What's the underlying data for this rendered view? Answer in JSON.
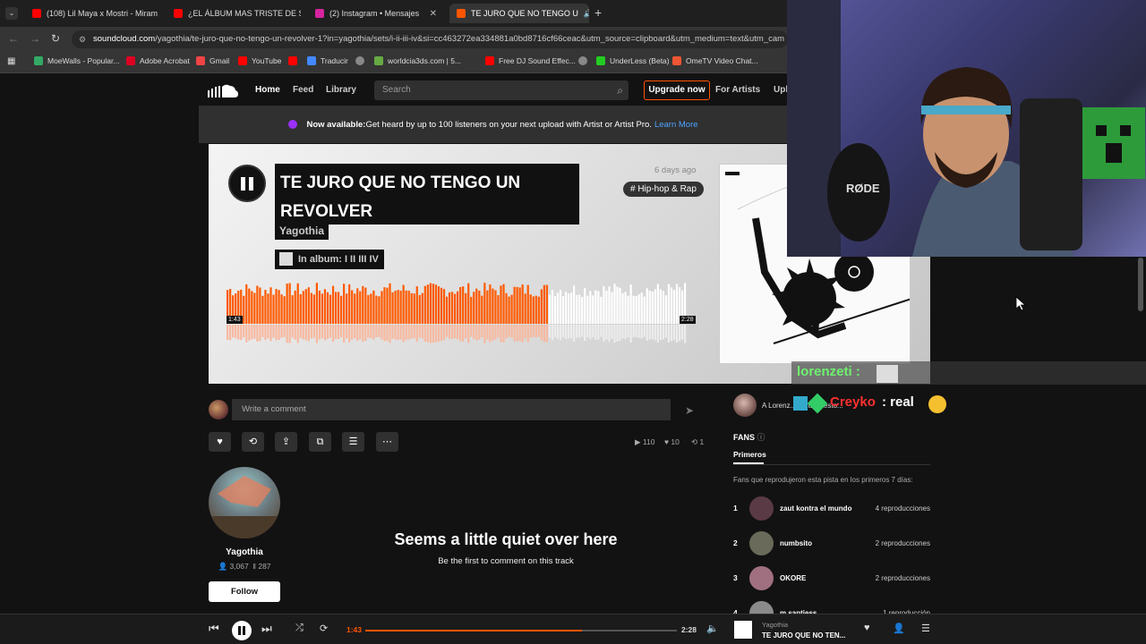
{
  "tabs": [
    {
      "title": "(108) Lil Maya x Mostri - Miram",
      "color": "#ff0000"
    },
    {
      "title": "¿EL ÁLBUM MAS TRISTE DE SU",
      "color": "#ff0000"
    },
    {
      "title": "(2) Instagram • Mensajes",
      "color": "#d6249f"
    },
    {
      "title": "TE JURO QUE NO TENGO U",
      "color": "#ff5500"
    }
  ],
  "url": {
    "host": "soundcloud.com",
    "path": "/yagothia/te-juro-que-no-tengo-un-revolver-1?in=yagothia/sets/i-ii-iii-iv&si=cc463272ea334881a0bd8716cf66ceac&utm_source=clipboard&utm_medium=text&utm_cam"
  },
  "bookmarks": [
    "MoeWalls - Popular...",
    "Adobe Acrobat",
    "Gmail",
    "YouTube",
    "",
    "Traducir",
    "",
    "worldcia3ds.com | 5...",
    "Free DJ Sound Effec...",
    "",
    "UnderLess (Beta)",
    "OmeTV Video Chat..."
  ],
  "nav": {
    "home": "Home",
    "feed": "Feed",
    "library": "Library",
    "search_placeholder": "Search",
    "upgrade": "Upgrade now",
    "for_artists": "For Artists",
    "upload": "Upl"
  },
  "banner": {
    "bold": "Now available:",
    "text": " Get heard by up to 100 listeners on your next upload with Artist or Artist Pro.",
    "link": "Learn More"
  },
  "track": {
    "title": "TE JURO QUE NO TENGO UN REVOLVER",
    "artist": "Yagothia",
    "album": "In album: I II III IV",
    "date_ago": "6 days ago",
    "genre": "# Hip-hop & Rap",
    "time_current": "1:43",
    "time_total": "2:28",
    "progress": 0.696
  },
  "comment": {
    "placeholder": "Write a comment"
  },
  "stats": {
    "plays": "110",
    "likes": "10",
    "reposts": "1"
  },
  "artist_card": {
    "name": "Yagothia",
    "followers": "3,067",
    "tracks": "287",
    "follow": "Follow"
  },
  "empty_comments": {
    "title": "Seems a little quiet over here",
    "subtitle": "Be the first to comment on this track"
  },
  "liked_by": "A Lorenz... ...gusta esto...",
  "fans": {
    "title": "FANS",
    "tab": "Primeros",
    "description": "Fans que reprodujeron esta pista en los primeros 7 días:",
    "rows": [
      {
        "rank": "1",
        "name": "zaut kontra el mundo",
        "count": "4 reproducciones",
        "color": "#5a3a44"
      },
      {
        "rank": "2",
        "name": "numbsito",
        "count": "2 reproducciones",
        "color": "#6a6a5a"
      },
      {
        "rank": "3",
        "name": "OKORE",
        "count": "2 reproducciones",
        "color": "#a07080"
      },
      {
        "rank": "4",
        "name": "m.santiess",
        "count": "1 reproducción",
        "color": "#8a8a8a"
      }
    ]
  },
  "player": {
    "current": "1:43",
    "total": "2:28",
    "progress": 0.696,
    "artist": "Yagothia",
    "title": "TE JURO QUE NO TEN..."
  },
  "chat": {
    "user1": "lorenzeti :",
    "user2": "Creyko",
    "msg2": ": real"
  }
}
